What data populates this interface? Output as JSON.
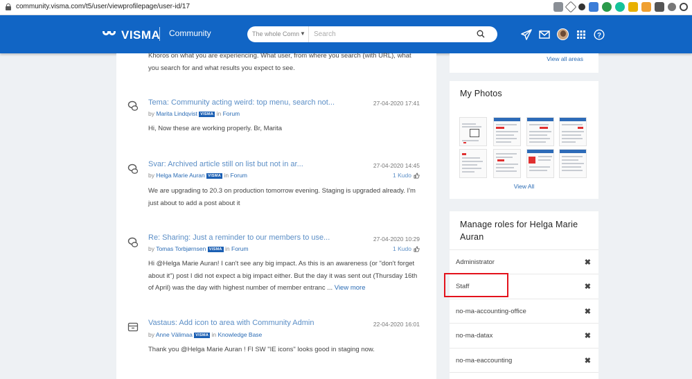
{
  "browser": {
    "url": "community.visma.com/t5/user/viewprofilepage/user-id/17"
  },
  "header": {
    "brand": "VISMA",
    "community_label": "Community",
    "search_scope": "The whole Comn",
    "search_placeholder": "Search"
  },
  "feed": {
    "intro_text": "Khoros on what you are experiencing. What user, from where you search (with URL), what you search for and what results you expect to see.",
    "posts": [
      {
        "icon": "discussion-icon",
        "title": "Tema: Community acting weird: top menu, search not...",
        "date": "27-04-2020 17:41",
        "by": "by",
        "author": "Marita Lindqvist",
        "badge": "VISMA",
        "in": "in",
        "board": "Forum",
        "kudos": "",
        "body": "Hi, Now these are working properly.   Br, Marita",
        "more": ""
      },
      {
        "icon": "discussion-icon",
        "title": "Svar: Archived article still on list but not in ar...",
        "date": "27-04-2020 14:45",
        "by": "by",
        "author": "Helga Marie Auran",
        "badge": "VISMA",
        "in": "in",
        "board": "Forum",
        "kudos": "1 Kudo",
        "body": "We are upgrading to 20.3 on production tomorrow evening. Staging is upgraded already. I'm just about to add a post about it",
        "more": ""
      },
      {
        "icon": "discussion-icon",
        "title": "Re: Sharing: Just a reminder to our members to use...",
        "date": "27-04-2020 10:29",
        "by": "by",
        "author": "Tomas Torbjørnsen",
        "badge": "VISMA",
        "in": "in",
        "board": "Forum",
        "kudos": "1 Kudo",
        "body": "Hi @Helga Marie Auran!   I can't see any big impact. As this is an awareness (or \"don't forget about it\") post I did not expect a big impact either. But the day it was sent out (Thursday 16th of April) was the day with highest number of member entranc ...",
        "more": "View more"
      },
      {
        "icon": "knowledge-base-icon",
        "title": "Vastaus: Add icon to area with Community Admin",
        "date": "22-04-2020 16:01",
        "by": "by",
        "author": "Anne Välimaa",
        "badge": "VISMA",
        "in": "in",
        "board": "Knowledge Base",
        "kudos": "",
        "body": "Thank you @Helga Marie Auran ! FI SW \"IE icons\" looks good in staging now.",
        "more": ""
      }
    ]
  },
  "sidebar": {
    "areas_link": "View all areas",
    "photos_title": "My Photos",
    "photos_view_all": "View All",
    "roles_title": "Manage roles for Helga Marie Auran",
    "roles": [
      {
        "name": "Administrator",
        "remove": "✖"
      },
      {
        "name": "Staff",
        "remove": "✖"
      },
      {
        "name": "no-ma-accounting-office",
        "remove": "✖"
      },
      {
        "name": "no-ma-datax",
        "remove": "✖"
      },
      {
        "name": "no-ma-eaccounting",
        "remove": "✖"
      }
    ],
    "highlighted_role": "Staff"
  },
  "colors": {
    "header_blue": "#1165c5",
    "link_blue": "#5b8ec6",
    "highlight_red": "#e3111b"
  }
}
